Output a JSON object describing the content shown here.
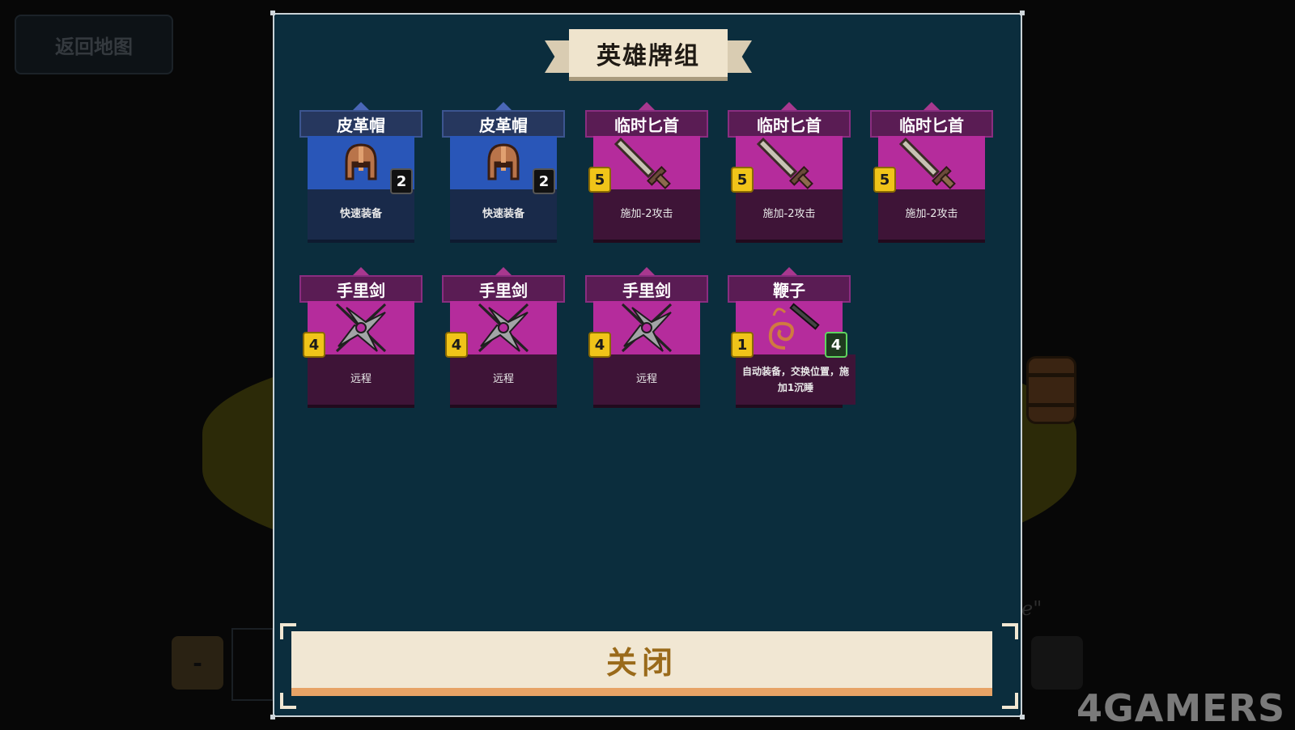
{
  "back_button": "返回地图",
  "panel_title": "英雄牌组",
  "close_label": "关闭",
  "watermark": "4GAMERS",
  "scene_text": "e\"",
  "nav_left_label": "-",
  "cards": [
    {
      "name": "皮革帽",
      "desc": "快速装备",
      "style": "blue",
      "icon": "helmet-icon",
      "badge_right": "2",
      "badge_left": null
    },
    {
      "name": "皮革帽",
      "desc": "快速装备",
      "style": "blue",
      "icon": "helmet-icon",
      "badge_right": "2",
      "badge_left": null
    },
    {
      "name": "临时匕首",
      "desc": "施加-2攻击",
      "style": "pink",
      "icon": "dagger-icon",
      "badge_right": null,
      "badge_left": "5"
    },
    {
      "name": "临时匕首",
      "desc": "施加-2攻击",
      "style": "pink",
      "icon": "dagger-icon",
      "badge_right": null,
      "badge_left": "5"
    },
    {
      "name": "临时匕首",
      "desc": "施加-2攻击",
      "style": "pink",
      "icon": "dagger-icon",
      "badge_right": null,
      "badge_left": "5"
    },
    {
      "name": "手里剑",
      "desc": "远程",
      "style": "pink",
      "icon": "shuriken-icon",
      "badge_right": null,
      "badge_left": "4"
    },
    {
      "name": "手里剑",
      "desc": "远程",
      "style": "pink",
      "icon": "shuriken-icon",
      "badge_right": null,
      "badge_left": "4"
    },
    {
      "name": "手里剑",
      "desc": "远程",
      "style": "pink",
      "icon": "shuriken-icon",
      "badge_right": null,
      "badge_left": "4"
    },
    {
      "name": "鞭子",
      "desc": "自动装备，交换位置，施加1沉睡",
      "style": "pink",
      "icon": "whip-icon",
      "badge_right": "4",
      "badge_left": "1"
    }
  ]
}
